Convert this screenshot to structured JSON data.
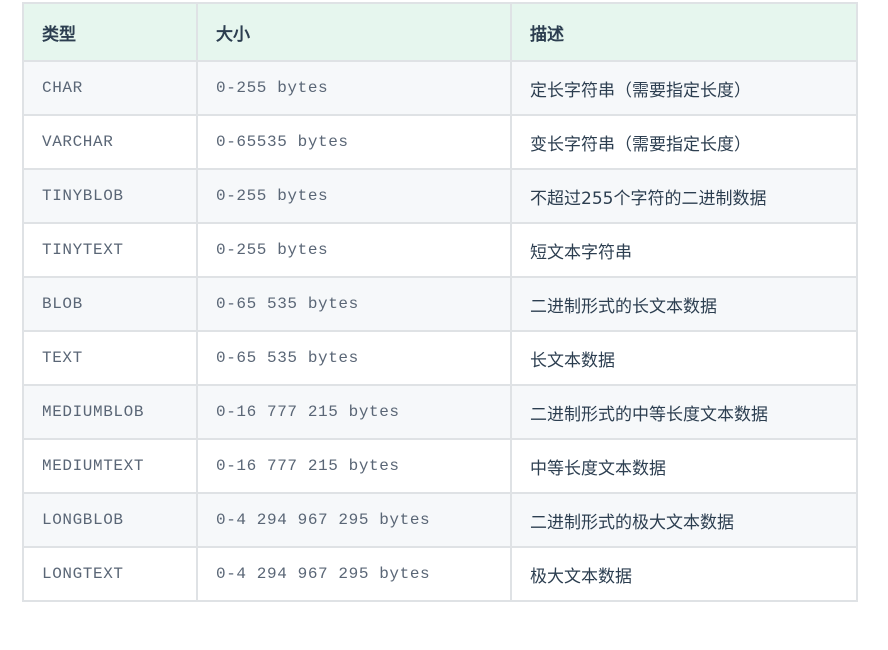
{
  "table": {
    "headers": [
      "类型",
      "大小",
      "描述"
    ],
    "rows": [
      {
        "type": "CHAR",
        "size": "0-255 bytes",
        "desc": "定长字符串（需要指定长度）"
      },
      {
        "type": "VARCHAR",
        "size": "0-65535 bytes",
        "desc": "变长字符串（需要指定长度）"
      },
      {
        "type": "TINYBLOB",
        "size": "0-255 bytes",
        "desc": "不超过255个字符的二进制数据"
      },
      {
        "type": "TINYTEXT",
        "size": "0-255 bytes",
        "desc": "短文本字符串"
      },
      {
        "type": "BLOB",
        "size": "0-65 535 bytes",
        "desc": "二进制形式的长文本数据"
      },
      {
        "type": "TEXT",
        "size": "0-65 535 bytes",
        "desc": "长文本数据"
      },
      {
        "type": "MEDIUMBLOB",
        "size": "0-16 777 215 bytes",
        "desc": "二进制形式的中等长度文本数据"
      },
      {
        "type": "MEDIUMTEXT",
        "size": "0-16 777 215 bytes",
        "desc": "中等长度文本数据"
      },
      {
        "type": "LONGBLOB",
        "size": "0-4 294 967 295 bytes",
        "desc": "二进制形式的极大文本数据"
      },
      {
        "type": "LONGTEXT",
        "size": "0-4 294 967 295 bytes",
        "desc": "极大文本数据"
      }
    ]
  }
}
